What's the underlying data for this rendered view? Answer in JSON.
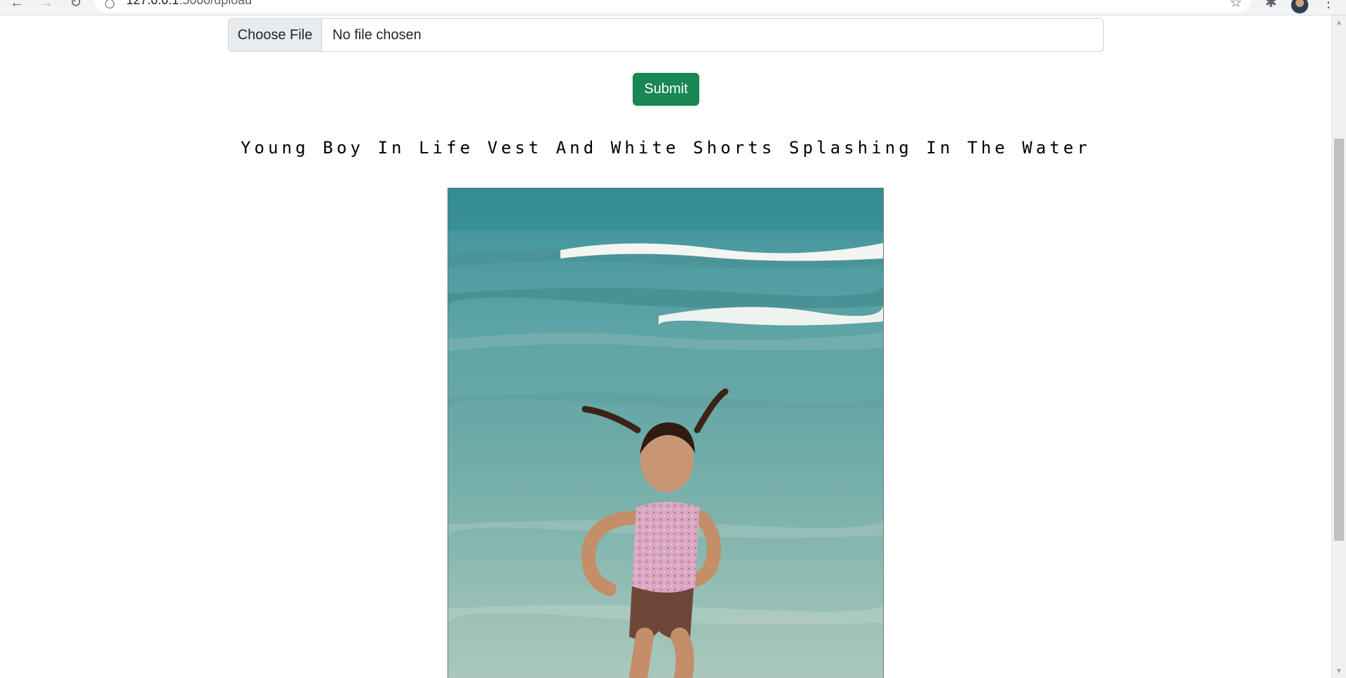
{
  "browser": {
    "back_icon": "←",
    "forward_icon": "→",
    "reload_icon": "↻",
    "url_host": "127.0.0.1",
    "url_rest": ":5000/upload",
    "star_icon": "☆",
    "extensions_icon": "✱",
    "menu_icon": "⋮"
  },
  "upload_form": {
    "choose_file_label": "Choose File",
    "file_status": "No file chosen",
    "submit_label": "Submit",
    "submit_color": "#198754"
  },
  "result": {
    "caption": "Young Boy In Life Vest And White Shorts Splashing In The Water",
    "image_description_icon": "photo"
  },
  "scrollbar": {
    "up_icon": "▲",
    "down_icon": "▼"
  }
}
